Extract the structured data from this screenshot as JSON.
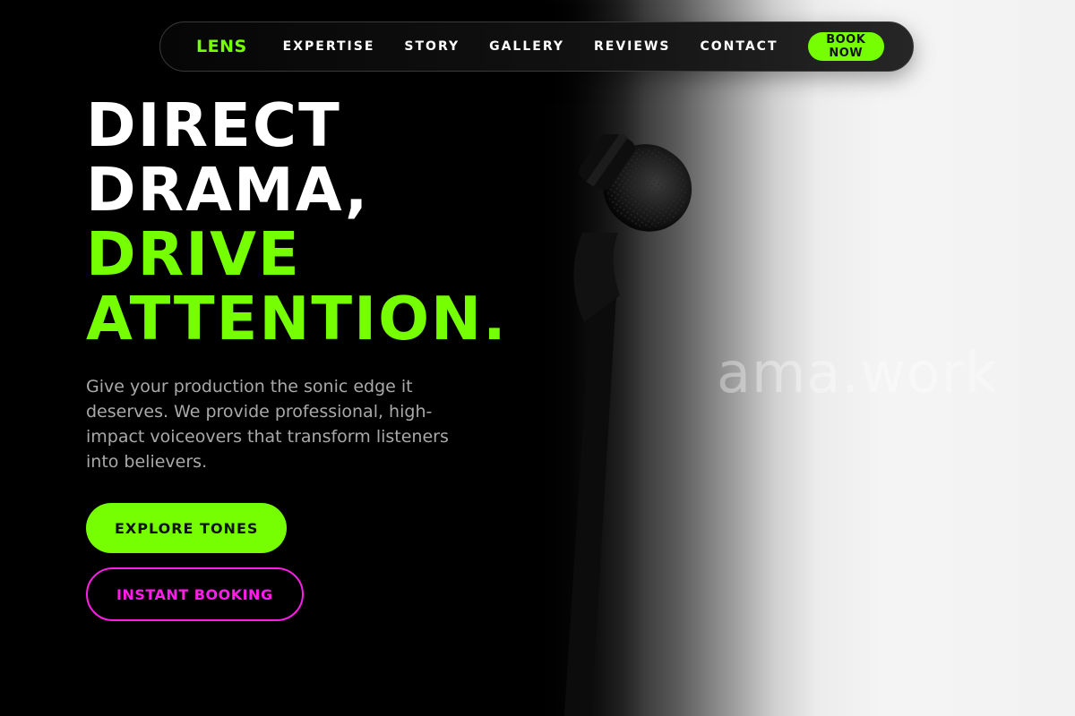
{
  "nav": {
    "logo": "LENS",
    "links": [
      "EXPERTISE",
      "STORY",
      "GALLERY",
      "REVIEWS",
      "CONTACT"
    ],
    "cta": "BOOK NOW"
  },
  "hero": {
    "headline_white": [
      "DIRECT",
      "DRAMA,"
    ],
    "headline_accent": [
      "DRIVE",
      "ATTENTION."
    ],
    "subtitle": "Give your production the sonic edge it deserves. We provide professional, high-impact voiceovers that transform listeners into believers.",
    "primary_button": "EXPLORE TONES",
    "secondary_button": "INSTANT BOOKING",
    "watermark": "ama.work"
  },
  "colors": {
    "accent": "#76ff03",
    "secondary_accent": "#ff1de8",
    "background": "#000000"
  },
  "icons": {
    "hero_image": "microphone-icon"
  }
}
